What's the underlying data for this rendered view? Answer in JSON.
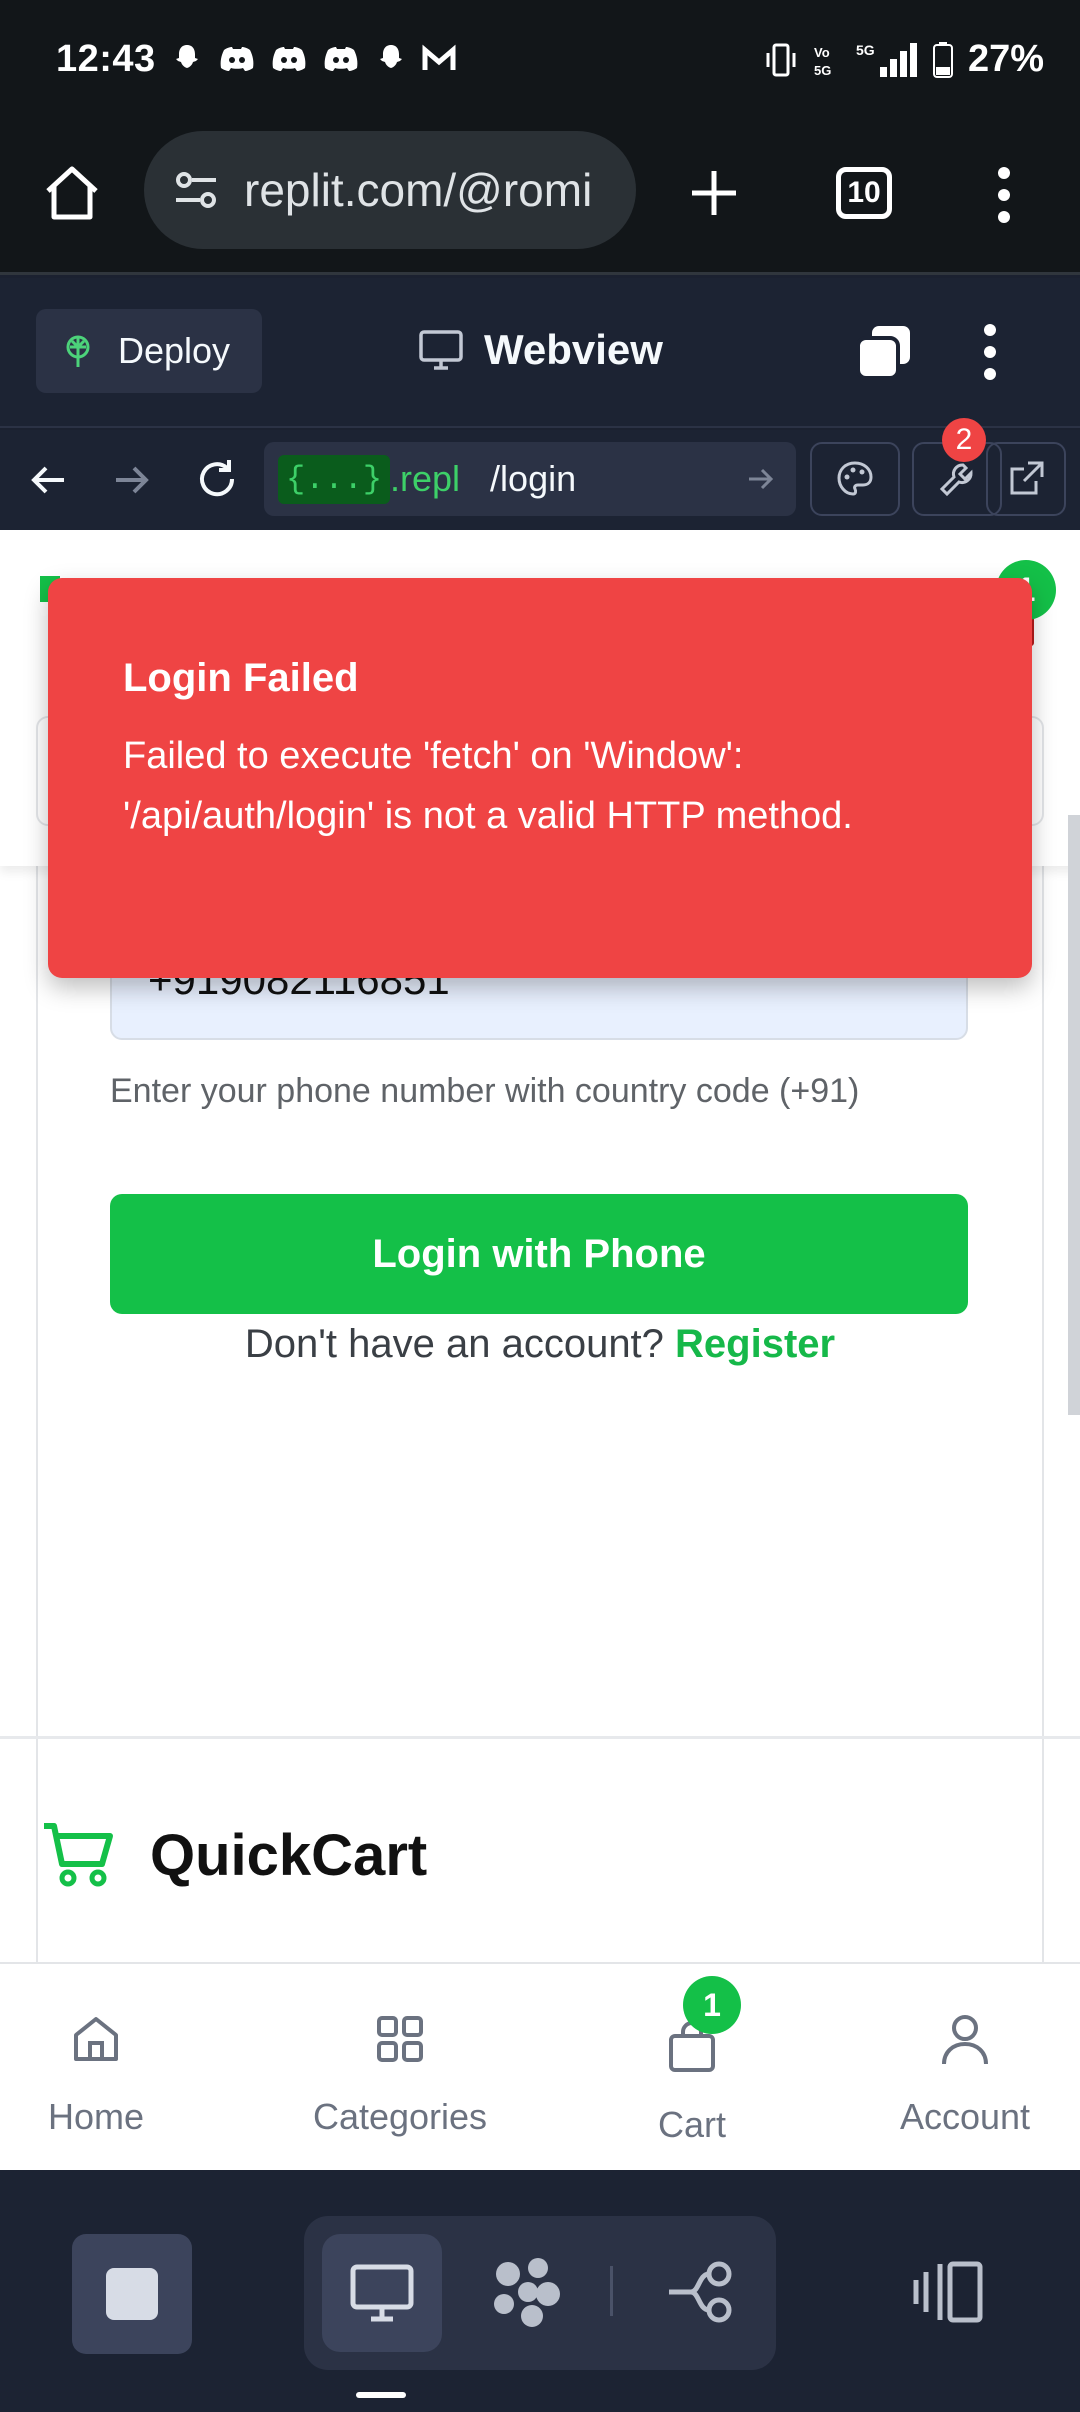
{
  "status_bar": {
    "time": "12:43",
    "battery": "27%",
    "network": "5G"
  },
  "browser": {
    "url": "replit.com/@romi",
    "tab_count": "10"
  },
  "replit_toolbar": {
    "deploy_label": "Deploy",
    "webview_label": "Webview"
  },
  "webview_nav": {
    "domain_chip": "{...}",
    "domain_suffix": ".repl",
    "path": "/login",
    "devtools_badge": "2"
  },
  "toast": {
    "title": "Login Failed",
    "message": "Failed to execute 'fetch' on 'Window': '/api/auth/login' is not a valid HTTP method."
  },
  "login_form": {
    "phone_value": "+919082116851",
    "phone_help": "Enter your phone number with country code (+91)",
    "login_button": "Login with Phone",
    "register_prompt": "Don't have an account?",
    "register_link": "Register"
  },
  "header_badge": "1",
  "footer_brand": "QuickCart",
  "bottom_nav": {
    "home": "Home",
    "categories": "Categories",
    "cart": "Cart",
    "cart_count": "1",
    "account": "Account"
  },
  "colors": {
    "accent_green": "#14c048",
    "toast_red": "#ef4444",
    "replit_bg": "#1c2333"
  }
}
